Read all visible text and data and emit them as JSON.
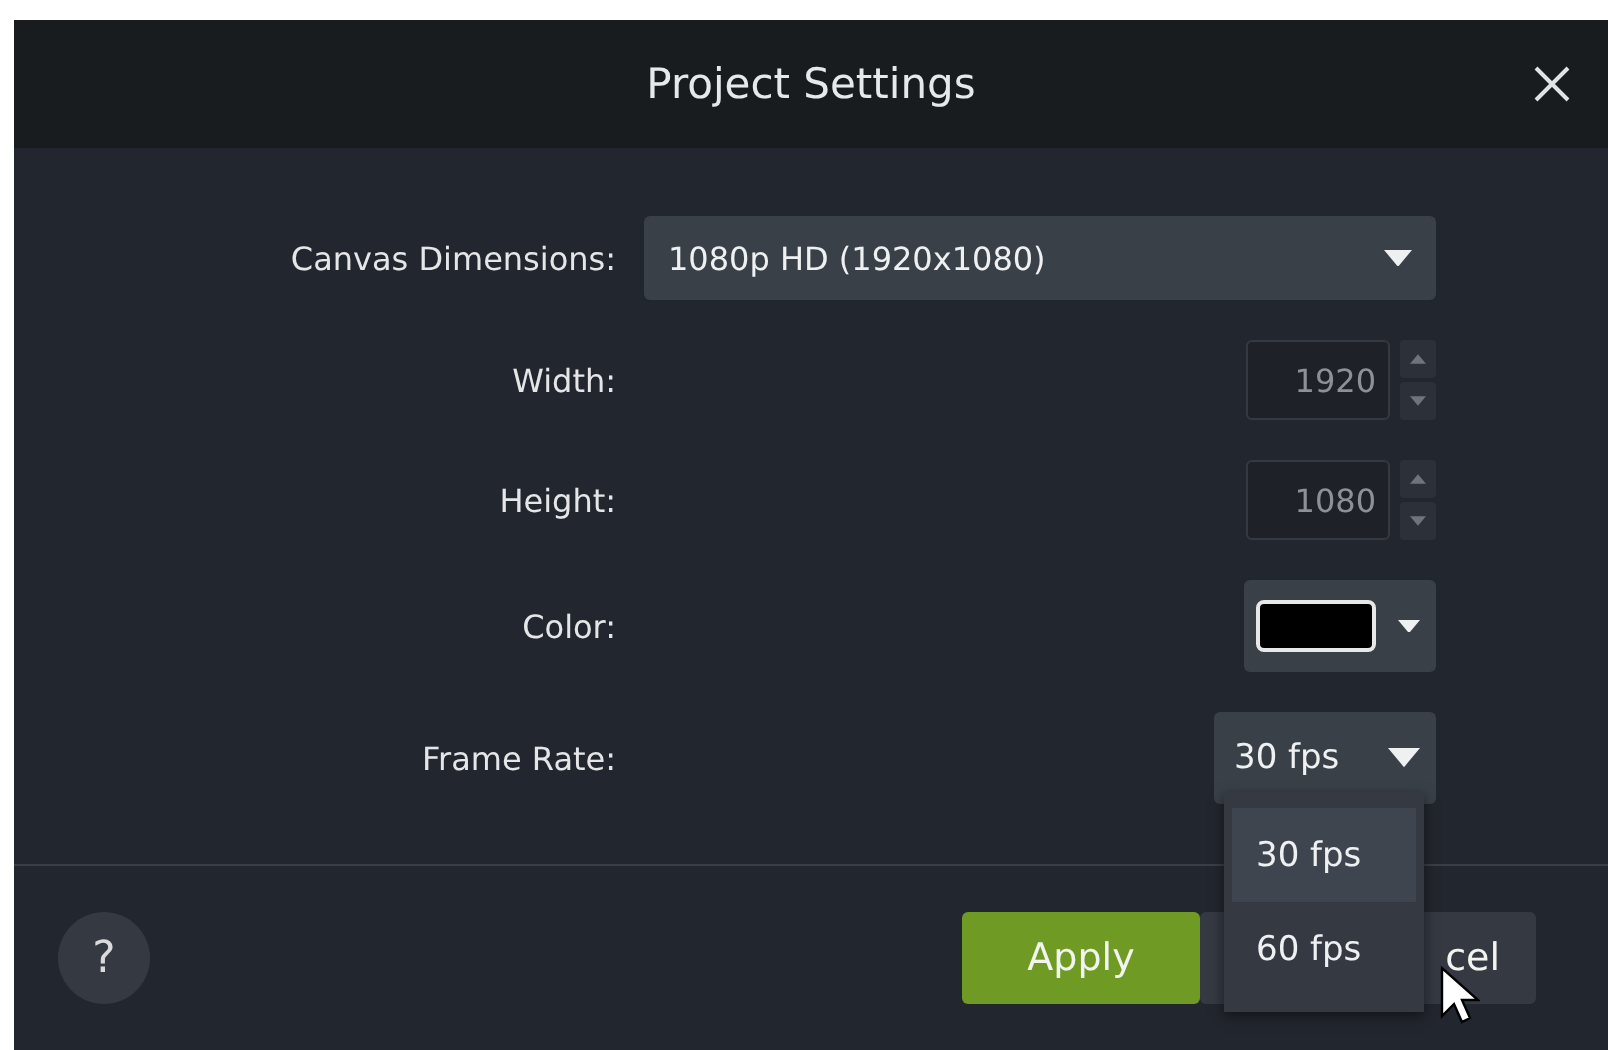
{
  "window": {
    "title": "Project Settings"
  },
  "fields": [
    {
      "kind": "select",
      "label": "Canvas Dimensions:",
      "value": "1080p HD (1920x1080)"
    },
    {
      "kind": "number",
      "label": "Width:",
      "value": "1920",
      "disabled": true
    },
    {
      "kind": "number",
      "label": "Height:",
      "value": "1080",
      "disabled": true
    },
    {
      "kind": "color",
      "label": "Color:",
      "color": "#000000"
    },
    {
      "kind": "compact-select",
      "label": "Frame Rate:",
      "value": "30 fps",
      "expanded": true,
      "options": [
        {
          "label": "30 fps",
          "selected": true
        },
        {
          "label": "60 fps",
          "selected": false
        }
      ]
    }
  ],
  "buttons": [
    {
      "kind": "primary",
      "label": "Apply"
    },
    {
      "kind": "secondary",
      "label": "cel"
    }
  ],
  "help": {
    "label": "?"
  }
}
